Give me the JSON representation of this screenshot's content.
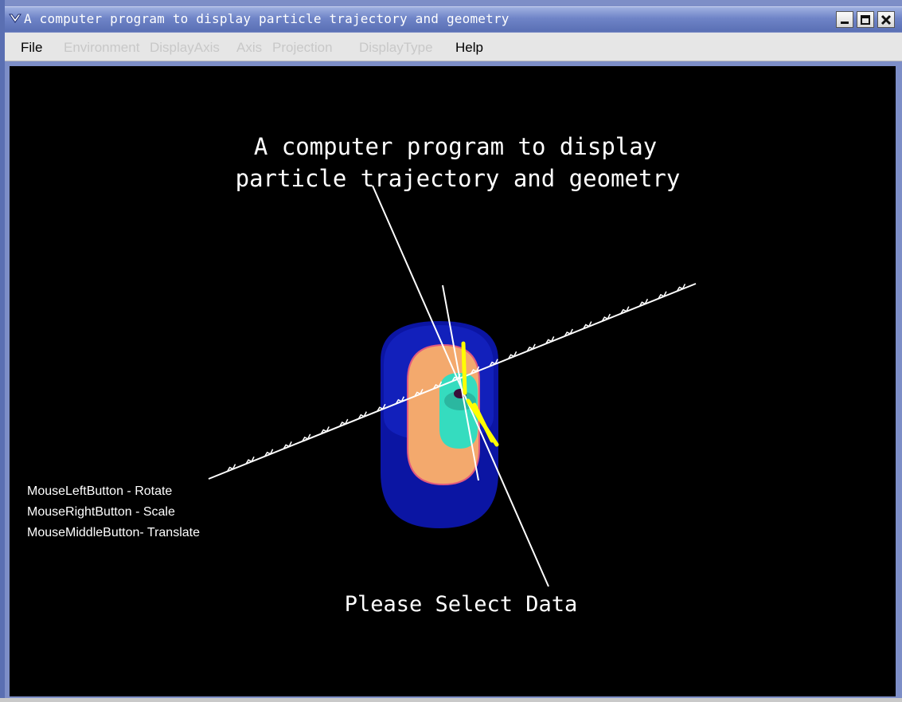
{
  "window": {
    "title": "A computer program to display particle trajectory and geometry"
  },
  "menubar": {
    "items": [
      {
        "label": "File",
        "enabled": true
      },
      {
        "label": "Environment",
        "enabled": false
      },
      {
        "label": "DisplayAxis",
        "enabled": false
      },
      {
        "label": "Axis",
        "enabled": false
      },
      {
        "label": "Projection",
        "enabled": false
      },
      {
        "label": "DisplayType",
        "enabled": false
      },
      {
        "label": "Help",
        "enabled": true
      }
    ]
  },
  "viewport": {
    "heading_line1": "A computer program to display",
    "heading_line2": "particle trajectory and geometry",
    "status_text": "Please Select Data",
    "help_lines": [
      "MouseLeftButton  - Rotate",
      "MouseRightButton - Scale",
      "MouseMiddleButton- Translate"
    ]
  },
  "colors": {
    "outer_cylinder": "#0c1aa8",
    "middle_cylinder": "#f4a96a",
    "inner_cylinder": "#37e0c2",
    "track": "#ffff00",
    "axis": "#ffffff",
    "background": "#000000"
  },
  "icons": {
    "window_menu": "chevron-down-icon",
    "minimize": "minimize-icon",
    "maximize": "maximize-icon",
    "close": "close-icon"
  }
}
